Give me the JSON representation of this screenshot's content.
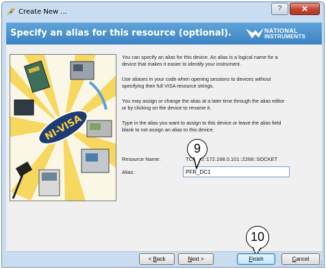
{
  "window": {
    "title": "Create New ..."
  },
  "title_buttons": {
    "help": "?",
    "close": "✕"
  },
  "header": {
    "title": "Specify an alias for this resource (optional).",
    "logo_line1": "NATIONAL",
    "logo_line2": "INSTRUMENTS"
  },
  "graphic": {
    "badge_text": "NI-VISA"
  },
  "description": [
    "You can specify an alias for this device. An alias is a logical name for a device that makes it easier to identify your instrument.",
    "Use aliases in your code when opening sessions to devices without specifying their full VISA resource strings.",
    "You may assign or change the alias at a later time through the alias editor or by clicking on the device to rename it.",
    "Type in the alias you want to assign to this device or leave the alias field blank to not assign an alias to this device."
  ],
  "fields": {
    "resource_label": "Resource Name:",
    "resource_value": "TCPIP0::172.168.0.101::2268::SOCKET",
    "alias_label": "Alias:",
    "alias_value": "PFR_DC1"
  },
  "callouts": {
    "nine": "9",
    "ten": "10"
  },
  "buttons": {
    "back_prefix": "< ",
    "back_key": "B",
    "back_rest": "ack",
    "next_key": "N",
    "next_rest": "ext >",
    "finish_key": "F",
    "finish_rest": "inish",
    "cancel_key": "C",
    "cancel_rest": "ancel"
  }
}
